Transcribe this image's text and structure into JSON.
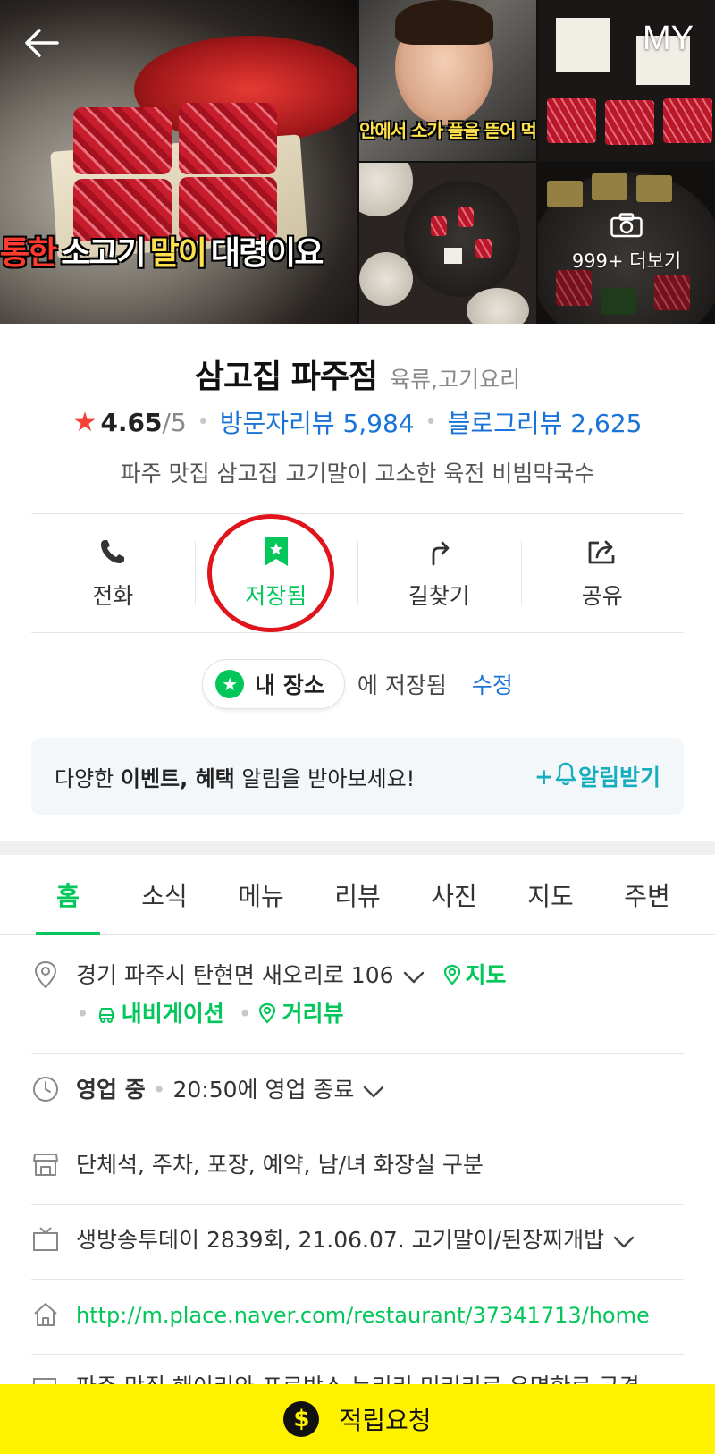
{
  "header": {
    "my_label": "MY",
    "main_photo_caption": [
      "통한",
      "소고기",
      "말이",
      "대령이요"
    ],
    "baby_photo_caption": "안에서 소가 풀을 뜯어 먹는",
    "more_photos_label": "999+ 더보기"
  },
  "place": {
    "name": "삼고집 파주점",
    "category": "육류,고기요리",
    "rating": "4.65",
    "rating_max": "/5",
    "visitor_reviews": "방문자리뷰 5,984",
    "blog_reviews": "블로그리뷰 2,625",
    "description": "파주 맛집 삼고집 고기말이 고소한 육전 비빔막국수"
  },
  "actions": {
    "call": "전화",
    "saved": "저장됨",
    "directions": "길찾기",
    "share": "공유"
  },
  "saved_status": {
    "chip_label": "내 장소",
    "saved_text": "에 저장됨",
    "edit_label": "수정"
  },
  "banner": {
    "text_prefix": "다양한 ",
    "text_bold": "이벤트, 혜택",
    "text_suffix": " 알림을 받아보세요!",
    "button_prefix": "+",
    "button_label": "알림받기"
  },
  "tabs": [
    "홈",
    "소식",
    "메뉴",
    "리뷰",
    "사진",
    "지도",
    "주변"
  ],
  "info": {
    "address": "경기 파주시 탄현면 새오리로 106",
    "map_link": "지도",
    "navigation_link": "내비게이션",
    "streetview_link": "거리뷰",
    "status": "영업 중",
    "hours": "20:50에 영업 종료",
    "amenities": "단체석, 주차, 포장, 예약, 남/녀 화장실 구분",
    "tv": "생방송투데이 2839회, 21.06.07. 고기말이/된장찌개밥",
    "url": "http://m.place.naver.com/restaurant/37341713/home",
    "cut_text": "파주 맛집 해이리와 프로방스 누리리 미리리로 유명한로 근경"
  },
  "bottom_bar": {
    "label": "적립요청",
    "coin_symbol": "$"
  },
  "colors": {
    "naver_green": "#03c75a",
    "link_blue": "#1a73d6",
    "highlight_red": "#e0141b",
    "bottom_yellow": "#fff200"
  }
}
